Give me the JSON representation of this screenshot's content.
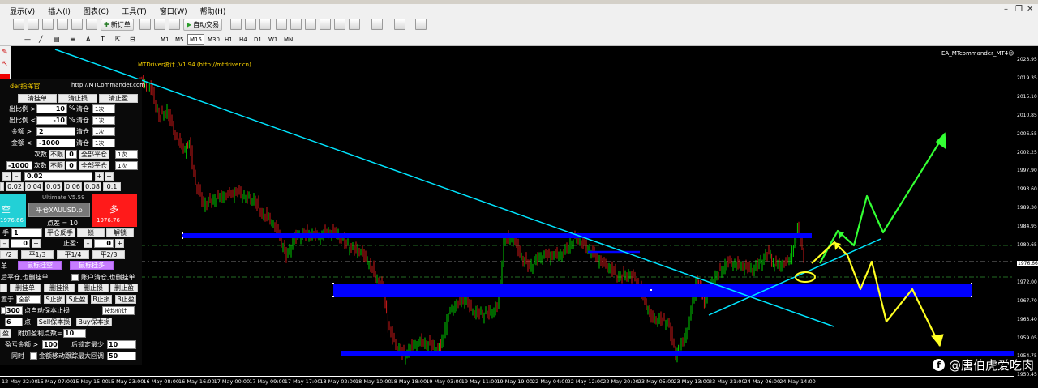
{
  "menu": [
    "显示(V)",
    "插入(I)",
    "图表(C)",
    "工具(T)",
    "窗口(W)",
    "帮助(H)"
  ],
  "toolbar": {
    "new_order": "新订单",
    "auto_trade": "自动交易"
  },
  "timeframes": [
    "M1",
    "M5",
    "M15",
    "M30",
    "H1",
    "H4",
    "D1",
    "W1",
    "MN"
  ],
  "active_timeframe": "M15",
  "chart": {
    "indicator_label": "MTDriver统计 ,V1.94 (http://mtdriver.cn)",
    "ea_label": "EA_MTcommander_MT4☺",
    "current_price": "1976.66",
    "price_labels": [
      "2023.95",
      "2019.35",
      "2015.10",
      "2010.85",
      "2006.55",
      "2002.25",
      "1997.90",
      "1993.60",
      "1989.30",
      "1984.95",
      "1980.65",
      "1976.66",
      "1972.00",
      "1967.70",
      "1963.40",
      "1959.05",
      "1954.75",
      "1950.45"
    ],
    "time_labels": [
      "12 May 22:00",
      "15 May 07:00",
      "15 May 15:00",
      "15 May 23:00",
      "16 May 08:00",
      "16 May 16:00",
      "17 May 00:00",
      "17 May 09:00",
      "17 May 17:00",
      "18 May 02:00",
      "18 May 10:00",
      "18 May 18:00",
      "19 May 03:00",
      "19 May 11:00",
      "19 May 19:00",
      "22 May 04:00",
      "22 May 12:00",
      "22 May 20:00",
      "23 May 05:00",
      "23 May 13:00",
      "23 May 21:00",
      "24 May 06:00",
      "24 May 14:00"
    ],
    "colors": {
      "bull": "#00ff00",
      "bear": "#ff2020",
      "zone": "#0000ff",
      "trend": "#00e5ff",
      "green_arrow": "#33ff33",
      "yellow_arrow": "#ffff22"
    }
  },
  "panel": {
    "title": "der指挥官",
    "url": "http://MTCommander.com",
    "row1": [
      "清挂单",
      "清止损",
      "清止盈"
    ],
    "ratio_label_a": "出比例 >",
    "ratio_value_a": "10",
    "ratio_label_b": "出比例 <",
    "ratio_value_b": "-10",
    "amount_label_a": "金额 >",
    "amount_value_a": "2",
    "amount_label_b": "金额 <",
    "amount_value_b": "-1000",
    "unit_pct": "%",
    "clear_pos": "清仓",
    "once": "1次",
    "times_label": "次数",
    "unlimited": "不限",
    "zero": "0",
    "close_all": "全部平仓",
    "neg_value": "-1000",
    "lot_value": "0.02",
    "quick_lots": [
      "0.02",
      "0.04",
      "0.05",
      "0.06",
      "0.08",
      "0.1"
    ],
    "sell_label": "空",
    "sell_price": "1976.66",
    "buy_label": "多",
    "buy_price": "1976.76",
    "version": "Ultimate V5.59",
    "close_symbol": "平仓XAUUSD.p",
    "spread": "点差 = 10",
    "hand_label": "手",
    "hand_value": "1",
    "reverse": "平仓反手",
    "lock": "锁",
    "unlock": "解锁",
    "stop_loss": "止盈:",
    "fraction_buttons": [
      "/2",
      "平1/3",
      "平1/4",
      "平2/3"
    ],
    "dan": "单",
    "mouse_sell": "鼠标挂空",
    "mouse_buy": "鼠标挂多",
    "note_a": "后平仓,也删挂单",
    "note_b": "账户清仓,也删挂单",
    "row_del": [
      "删挂单",
      "删挂损",
      "删止损",
      "删止盈"
    ],
    "set_label": "置于",
    "all_select": "全部",
    "sl_buttons": [
      "S止损",
      "S止盈",
      "B止损",
      "B止盈"
    ],
    "auto_label": "点自动保本止损",
    "auto_value": "300",
    "trail_select": "按均价计",
    "point_value": "6",
    "point_label": "点",
    "sell_be": "Sell保本损",
    "buy_be": "Buy保本损",
    "profit_label": "盈",
    "add_points": "附加盈利点数=",
    "add_points_value": "10",
    "profit_amount": "盈亏金额 >",
    "profit_amount_value": "100",
    "after_lock": "后锁定最少",
    "after_lock_value": "10",
    "also_label": "同时",
    "track_label": "金额移动跟踪最大回调",
    "track_value": "50"
  },
  "watermark": "@唐伯虎爱吃肉"
}
